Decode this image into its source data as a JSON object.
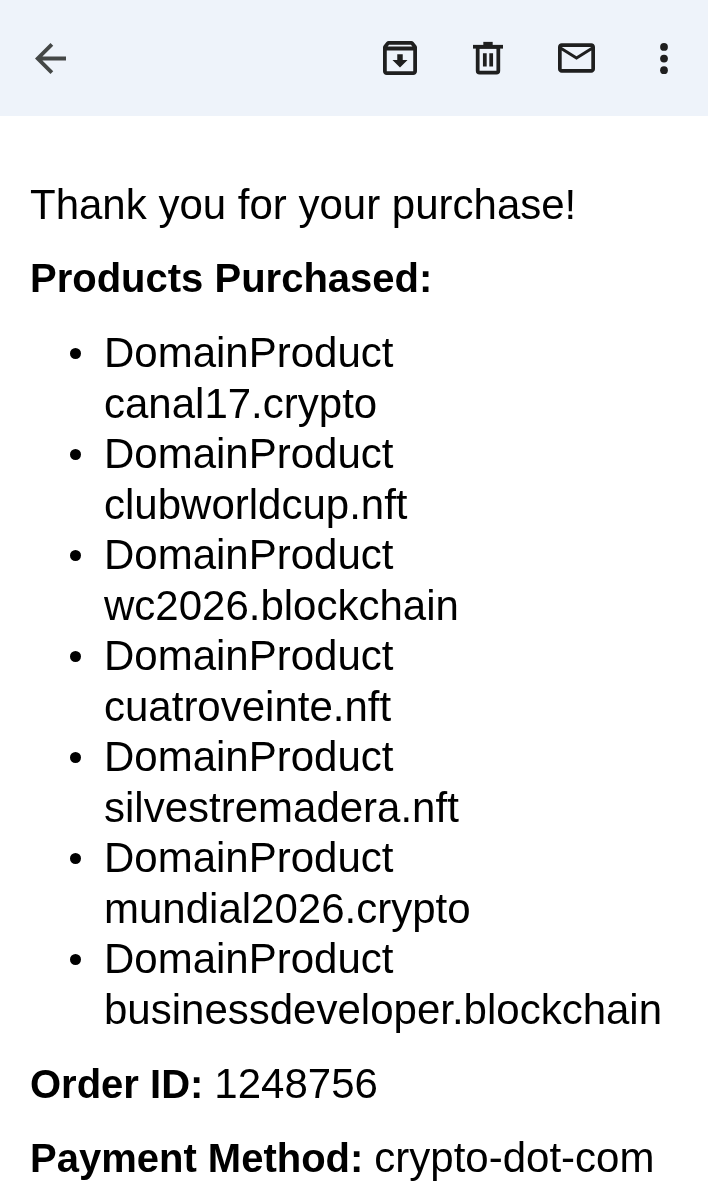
{
  "message": {
    "greeting": "Thank you for your purchase!",
    "products_heading": "Products Purchased:",
    "products": [
      {
        "type": "DomainProduct",
        "name": "canal17.crypto"
      },
      {
        "type": "DomainProduct",
        "name": "clubworldcup.nft"
      },
      {
        "type": "DomainProduct",
        "name": "wc2026.blockchain"
      },
      {
        "type": "DomainProduct",
        "name": "cuatroveinte.nft"
      },
      {
        "type": "DomainProduct",
        "name": "silvestremadera.nft"
      },
      {
        "type": "DomainProduct",
        "name": "mundial2026.crypto"
      },
      {
        "type": "DomainProduct",
        "name": "businessdeveloper.blockchain"
      }
    ],
    "details": [
      {
        "label": "Order ID:",
        "value": "1248756"
      },
      {
        "label": "Payment Method:",
        "value": "crypto-dot-com"
      }
    ]
  }
}
